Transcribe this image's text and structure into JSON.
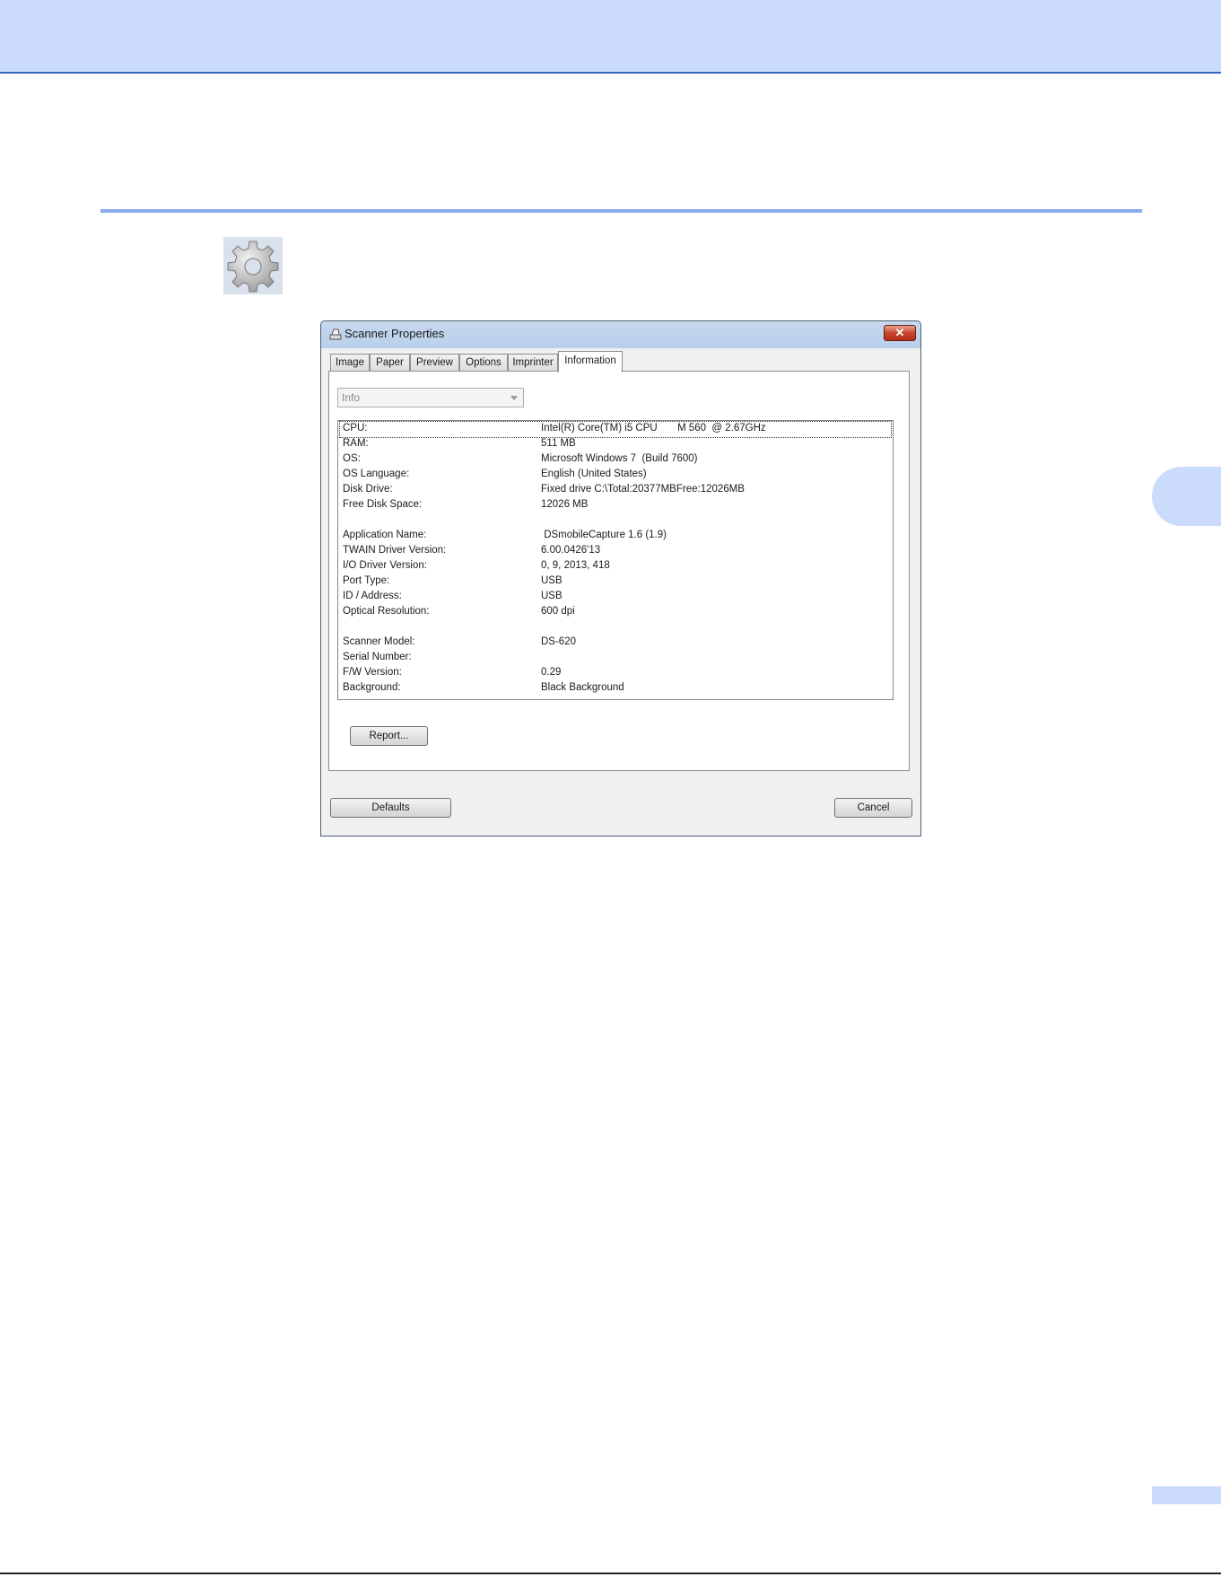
{
  "dialog": {
    "title": "Scanner Properties",
    "close_glyph": "✕",
    "tabs": [
      {
        "label": "Image"
      },
      {
        "label": "Paper"
      },
      {
        "label": "Preview"
      },
      {
        "label": "Options"
      },
      {
        "label": "Imprinter"
      },
      {
        "label": "Information",
        "active": true
      }
    ],
    "dropdown": {
      "value": "Info"
    },
    "info_rows": [
      {
        "key": "CPU:",
        "value": "Intel(R) Core(TM) i5 CPU       M 560  @ 2.67GHz"
      },
      {
        "key": "RAM:",
        "value": "511 MB"
      },
      {
        "key": "OS:",
        "value": "Microsoft Windows 7  (Build 7600)"
      },
      {
        "key": "OS Language:",
        "value": "English (United States)"
      },
      {
        "key": "Disk Drive:",
        "value": "Fixed drive C:\\Total:20377MBFree:12026MB"
      },
      {
        "key": "Free Disk Space:",
        "value": "12026 MB"
      },
      {
        "key": "Application Name:",
        "value": " DSmobileCapture 1.6 (1.9)"
      },
      {
        "key": "TWAIN Driver Version:",
        "value": "6.00.0426'13"
      },
      {
        "key": "I/O Driver Version:",
        "value": "0, 9, 2013, 418"
      },
      {
        "key": "Port Type:",
        "value": "USB"
      },
      {
        "key": "ID / Address:",
        "value": "USB"
      },
      {
        "key": "Optical Resolution:",
        "value": "600 dpi"
      },
      {
        "key": "Scanner Model:",
        "value": "DS-620"
      },
      {
        "key": "Serial Number:",
        "value": ""
      },
      {
        "key": "F/W Version:",
        "value": "0.29"
      },
      {
        "key": "Background:",
        "value": "Black Background"
      }
    ],
    "report_button": "Report...",
    "defaults_button": "Defaults",
    "cancel_button": "Cancel"
  },
  "icons": {
    "settings": "gear-icon",
    "scanner": "scanner-icon"
  },
  "colors": {
    "header_band": "#cbdbfb",
    "rule": "#8aa9f0",
    "close_button": "#c7462f"
  }
}
